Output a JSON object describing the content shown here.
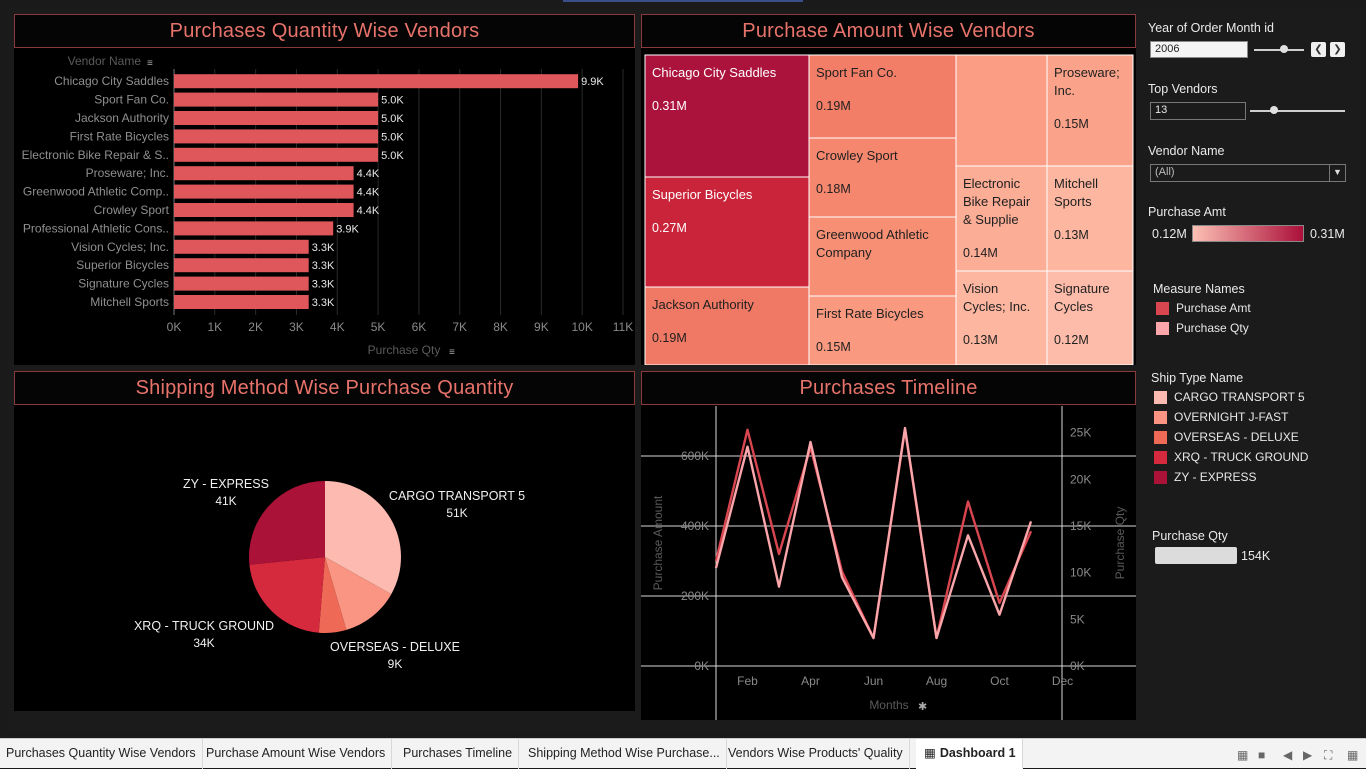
{
  "panels": {
    "qty_title": "Purchases Quantity Wise Vendors",
    "amt_title": "Purchase Amount Wise Vendors",
    "ship_title": "Shipping Method Wise Purchase Quantity",
    "time_title": "Purchases Timeline"
  },
  "chart_data": [
    {
      "type": "bar",
      "orientation": "horizontal",
      "title": "Purchases Quantity Wise Vendors",
      "category_header": "Vendor Name",
      "xlabel": "Purchase Qty",
      "xlim": [
        0,
        11000
      ],
      "xticks": [
        "0K",
        "1K",
        "2K",
        "3K",
        "4K",
        "5K",
        "6K",
        "7K",
        "8K",
        "9K",
        "10K",
        "11K"
      ],
      "color": "#e0575b",
      "categories": [
        "Chicago City Saddles",
        "Sport Fan Co.",
        "Jackson Authority",
        "First Rate Bicycles",
        "Electronic Bike Repair & S..",
        "Proseware; Inc.",
        "Greenwood Athletic Comp..",
        "Crowley Sport",
        "Professional Athletic Cons..",
        "Vision Cycles; Inc.",
        "Superior Bicycles",
        "Signature Cycles",
        "Mitchell Sports"
      ],
      "values": [
        9900,
        5000,
        5000,
        5000,
        5000,
        4400,
        4400,
        4400,
        3900,
        3300,
        3300,
        3300,
        3300
      ],
      "value_labels": [
        "9.9K",
        "5.0K",
        "5.0K",
        "5.0K",
        "5.0K",
        "4.4K",
        "4.4K",
        "4.4K",
        "3.9K",
        "3.3K",
        "3.3K",
        "3.3K",
        "3.3K"
      ]
    },
    {
      "type": "treemap",
      "title": "Purchase Amount Wise Vendors",
      "color_scale": [
        "#fcc0b4",
        "#ab0f3a"
      ],
      "items": [
        {
          "name": "Chicago City Saddles",
          "value": 0.31,
          "label": "0.31M",
          "color": "#ab133c"
        },
        {
          "name": "Superior Bicycles",
          "value": 0.27,
          "label": "0.27M",
          "color": "#c9243a"
        },
        {
          "name": "Jackson Authority",
          "value": 0.19,
          "label": "0.19M",
          "color": "#f07965"
        },
        {
          "name": "Sport Fan Co.",
          "value": 0.19,
          "label": "0.19M",
          "color": "#f27e68"
        },
        {
          "name": "Crowley Sport",
          "value": 0.18,
          "label": "0.18M",
          "color": "#f5876f"
        },
        {
          "name": "Greenwood Athletic Company",
          "value": 0.16,
          "label": "",
          "color": "#f78f75"
        },
        {
          "name": "First Rate Bicycles",
          "value": 0.15,
          "label": "0.15M",
          "color": "#f99a80"
        },
        {
          "name": "",
          "value": 0.15,
          "label": "",
          "color": "#fb9d84"
        },
        {
          "name": "Proseware; Inc.",
          "value": 0.15,
          "label": "0.15M",
          "color": "#fba38a"
        },
        {
          "name": "Electronic Bike Repair & Supplie",
          "value": 0.14,
          "label": "0.14M",
          "color": "#fcad96"
        },
        {
          "name": "Mitchell Sports",
          "value": 0.13,
          "label": "0.13M",
          "color": "#fdb6a0"
        },
        {
          "name": "Vision Cycles; Inc.",
          "value": 0.13,
          "label": "0.13M",
          "color": "#fdb6a0"
        },
        {
          "name": "Signature Cycles",
          "value": 0.12,
          "label": "0.12M",
          "color": "#fdbcaa"
        }
      ]
    },
    {
      "type": "pie",
      "title": "Shipping Method Wise Purchase Quantity",
      "slices": [
        {
          "name": "CARGO TRANSPORT 5",
          "value": 51,
          "label": "51K",
          "color": "#fcbab0"
        },
        {
          "name": "OVERNIGHT J-FAST",
          "value": 19,
          "label": "",
          "color": "#f99582"
        },
        {
          "name": "OVERSEAS - DELUXE",
          "value": 9,
          "label": "9K",
          "color": "#ee6a56"
        },
        {
          "name": "XRQ - TRUCK GROUND",
          "value": 34,
          "label": "34K",
          "color": "#d5293d"
        },
        {
          "name": "ZY - EXPRESS",
          "value": 41,
          "label": "41K",
          "color": "#ab1237"
        }
      ]
    },
    {
      "type": "line",
      "title": "Purchases Timeline",
      "xlabel": "Months",
      "ylabel_left": "Purchase Amount",
      "ylabel_right": "Purchase Qty",
      "xticks": [
        "Feb",
        "Apr",
        "Jun",
        "Aug",
        "Oct",
        "Dec"
      ],
      "x": [
        "Jan",
        "Feb",
        "Mar",
        "Apr",
        "May",
        "Jun",
        "Jul",
        "Aug",
        "Sep",
        "Oct",
        "Nov"
      ],
      "ylim_left": [
        0,
        720000
      ],
      "yticks_left": [
        "0K",
        "200K",
        "400K",
        "600K"
      ],
      "ylim_right": [
        0,
        27000
      ],
      "yticks_right": [
        "0K",
        "5K",
        "10K",
        "15K",
        "20K",
        "25K"
      ],
      "series": [
        {
          "name": "Purchase Amt",
          "axis": "left",
          "color": "#d9464f",
          "values": [
            300000,
            675000,
            320000,
            625000,
            270000,
            80000,
            675000,
            80000,
            470000,
            180000,
            385000
          ]
        },
        {
          "name": "Purchase Qty",
          "axis": "right",
          "color": "#fba6ab",
          "values": [
            10500,
            23500,
            8500,
            24000,
            9500,
            3000,
            25500,
            3000,
            14000,
            5500,
            15500
          ]
        }
      ]
    }
  ],
  "filters": {
    "year_label": "Year of Order Month id",
    "year_value": "2006",
    "year_slider_level": 0.6,
    "prev_icon": "chevron-left-icon",
    "next_icon": "chevron-right-icon",
    "top_label": "Top Vendors",
    "top_value": "13",
    "top_slider_level": 0.25,
    "vendor_label": "Vendor Name",
    "vendor_value": "(All)",
    "vendor_icon": "chevron-down-icon"
  },
  "amt_legend": {
    "title": "Purchase Amt",
    "min": "0.12M",
    "max": "0.31M",
    "color_min": "#fcc0b4",
    "color_max": "#ab0f3a"
  },
  "measure_legend": {
    "title": "Measure Names",
    "items": [
      {
        "label": "Purchase Amt",
        "color": "#d9464f"
      },
      {
        "label": "Purchase Qty",
        "color": "#fba6ab"
      }
    ]
  },
  "ship_legend": {
    "title": "Ship Type Name",
    "items": [
      {
        "label": "CARGO TRANSPORT 5",
        "color": "#fcbab0"
      },
      {
        "label": "OVERNIGHT J-FAST",
        "color": "#f99582"
      },
      {
        "label": "OVERSEAS - DELUXE",
        "color": "#ee6a56"
      },
      {
        "label": "XRQ - TRUCK GROUND",
        "color": "#d5293d"
      },
      {
        "label": "ZY - EXPRESS",
        "color": "#ab1237"
      }
    ]
  },
  "qty_legend": {
    "title": "Purchase Qty",
    "value": "154K"
  },
  "tabs": [
    {
      "label": "Purchases Quantity Wise Vendors"
    },
    {
      "label": "Purchase Amount Wise Vendors"
    },
    {
      "label": "Purchases Timeline"
    },
    {
      "label": "Shipping Method Wise Purchase..."
    },
    {
      "label": "Vendors Wise Products' Quality"
    },
    {
      "label": "Dashboard 1",
      "active": true
    }
  ]
}
